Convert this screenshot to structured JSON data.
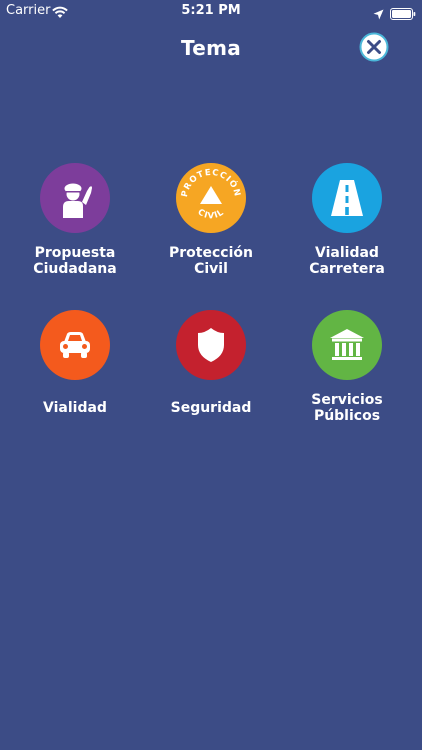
{
  "status_bar": {
    "carrier": "Carrier",
    "time": "5:21 PM",
    "wifi_icon": "wifi-icon",
    "location_icon": "location-arrow-icon",
    "battery_icon": "battery-icon"
  },
  "header": {
    "title": "Tema",
    "close_icon": "close-icon"
  },
  "colors": {
    "background": "#3c4c86",
    "propuesta": "#7d3d9b",
    "proteccion": "#f6a623",
    "vialidad_carretera": "#1aa3e0",
    "vialidad": "#f45a1d",
    "seguridad": "#c4212e",
    "servicios": "#62b544"
  },
  "topics": [
    {
      "label": "Propuesta\nCiudadana",
      "icon": "citizen-icon"
    },
    {
      "label": "Protección\nCivil",
      "icon": "civil-protection-icon",
      "badge_top": "PROTECCIÓN",
      "badge_bottom": "CIVIL"
    },
    {
      "label": "Vialidad\nCarretera",
      "icon": "highway-icon"
    },
    {
      "label": "Vialidad",
      "icon": "car-icon"
    },
    {
      "label": "Seguridad",
      "icon": "shield-icon"
    },
    {
      "label": "Servicios\nPúblicos",
      "icon": "building-icon"
    }
  ]
}
